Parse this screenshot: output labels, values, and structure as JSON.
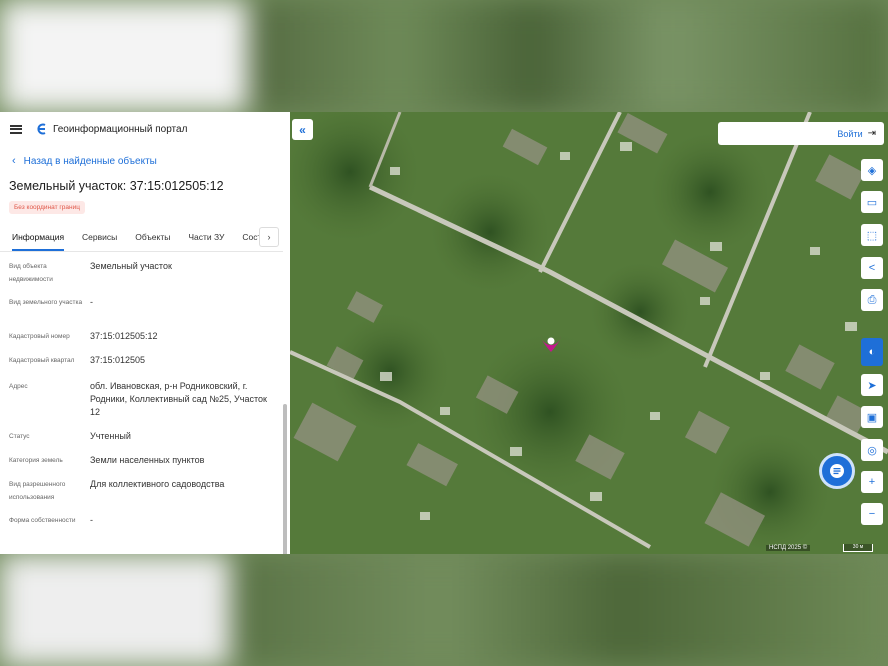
{
  "header": {
    "portal_title": "Геоинформационный портал"
  },
  "nav": {
    "back_label": "Назад в найденные объекты"
  },
  "object": {
    "title": "Земельный участок: 37:15:012505:12",
    "badge": "Без координат границ"
  },
  "tabs": [
    {
      "label": "Информация",
      "active": true
    },
    {
      "label": "Сервисы"
    },
    {
      "label": "Объекты"
    },
    {
      "label": "Части ЗУ"
    },
    {
      "label": "Состав"
    }
  ],
  "properties": [
    {
      "label": "Вид объекта недвижимости",
      "value": "Земельный участок"
    },
    {
      "label": "Вид земельного участка",
      "value": "-"
    },
    {
      "label": "Кадастровый номер",
      "value": "37:15:012505:12"
    },
    {
      "label": "Кадастровый квартал",
      "value": "37:15:012505"
    },
    {
      "label": "Адрес",
      "value": "обл. Ивановская, р-н Родниковский, г. Родники, Коллективный сад №25, Участок 12"
    },
    {
      "label": "Статус",
      "value": "Учтенный"
    },
    {
      "label": "Категория земель",
      "value": "Земли населенных пунктов"
    },
    {
      "label": "Вид разрешенного использования",
      "value": "Для коллективного садоводства"
    },
    {
      "label": "Форма собственности",
      "value": "-"
    }
  ],
  "map": {
    "login_label": "Войти",
    "attribution": "НСПД 2025 ©",
    "scale_label": "30 м",
    "tools": [
      "layers-icon",
      "legend-icon",
      "select-area-icon",
      "share-icon",
      "print-icon",
      "ruler-icon",
      "navigate-icon",
      "basemap-icon",
      "location-icon",
      "zoom-in-icon",
      "zoom-out-icon"
    ],
    "tool_symbols": [
      "◈",
      "▭",
      "⬚",
      "<",
      "⎙",
      "◐",
      "➤",
      "▣",
      "◎",
      "+",
      "−"
    ]
  },
  "colors": {
    "accent": "#1e6fd8",
    "marker": "#c2188c",
    "badge_text": "#e0584a"
  }
}
